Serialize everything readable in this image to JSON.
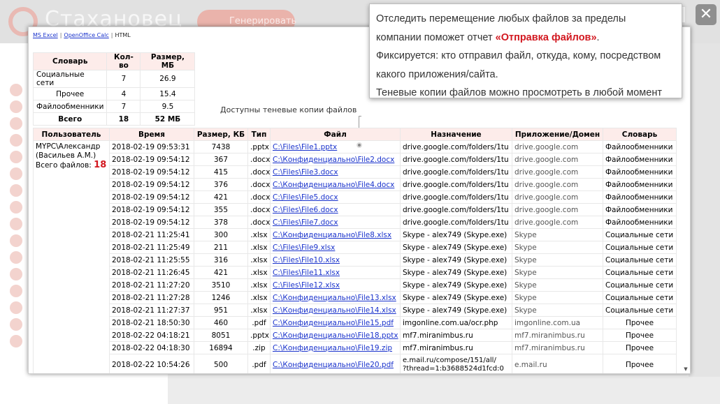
{
  "background": {
    "logo_text": "Стахановец",
    "generate_label": "Генерировать"
  },
  "close_label": "✕",
  "format_links": {
    "excel": "MS Excel",
    "calc": "OpenOffice Calc",
    "html": "HTML"
  },
  "summary": {
    "headers": [
      "Словарь",
      "Кол-во",
      "Размер, МБ"
    ],
    "rows": [
      [
        "Социальные сети",
        "7",
        "26.9"
      ],
      [
        "Прочее",
        "4",
        "15.4"
      ],
      [
        "Файлообменники",
        "7",
        "9.5"
      ]
    ],
    "total": [
      "Всего",
      "18",
      "52 МБ"
    ]
  },
  "annotation": "Доступны теневые копии файлов",
  "table": {
    "headers": [
      "Пользователь",
      "Время",
      "Размер, КБ",
      "Тип",
      "Файл",
      "Назначение",
      "Приложение/Домен",
      "Словарь"
    ],
    "user": {
      "name": "MYPC\\Александр (Васильев А.М.)",
      "files_label": "Всего файлов:",
      "files_count": "18"
    },
    "rows": [
      [
        "2018-02-19 09:53:31",
        "7438",
        ".pptx",
        "C:\\Files\\File1.pptx",
        "drive.google.com/folders/1tu",
        "drive.google.com",
        "Файлообменники"
      ],
      [
        "2018-02-19 09:54:12",
        "367",
        ".docx",
        "C:\\Конфиденциально\\File2.docx",
        "drive.google.com/folders/1tu",
        "drive.google.com",
        "Файлообменники"
      ],
      [
        "2018-02-19 09:54:12",
        "415",
        ".docx",
        "C:\\Files\\File3.docx",
        "drive.google.com/folders/1tu",
        "drive.google.com",
        "Файлообменники"
      ],
      [
        "2018-02-19 09:54:12",
        "376",
        ".docx",
        "C:\\Конфиденциально\\File4.docx",
        "drive.google.com/folders/1tu",
        "drive.google.com",
        "Файлообменники"
      ],
      [
        "2018-02-19 09:54:12",
        "421",
        ".docx",
        "C:\\Files\\File5.docx",
        "drive.google.com/folders/1tu",
        "drive.google.com",
        "Файлообменники"
      ],
      [
        "2018-02-19 09:54:12",
        "355",
        ".docx",
        "C:\\Files\\File6.docx",
        "drive.google.com/folders/1tu",
        "drive.google.com",
        "Файлообменники"
      ],
      [
        "2018-02-19 09:54:12",
        "378",
        ".docx",
        "C:\\Files\\File7.docx",
        "drive.google.com/folders/1tu",
        "drive.google.com",
        "Файлообменники"
      ],
      [
        "2018-02-21 11:25:41",
        "300",
        ".xlsx",
        "C:\\Конфиденциально\\File8.xlsx",
        "Skype - alex749 (Skype.exe)",
        "Skype",
        "Социальные сети"
      ],
      [
        "2018-02-21 11:25:49",
        "211",
        ".xlsx",
        "C:\\Files\\File9.xlsx",
        "Skype - alex749 (Skype.exe)",
        "Skype",
        "Социальные сети"
      ],
      [
        "2018-02-21 11:25:55",
        "316",
        ".xlsx",
        "C:\\Files\\File10.xlsx",
        "Skype - alex749 (Skype.exe)",
        "Skype",
        "Социальные сети"
      ],
      [
        "2018-02-21 11:26:45",
        "421",
        ".xlsx",
        "C:\\Files\\File11.xlsx",
        "Skype - alex749 (Skype.exe)",
        "Skype",
        "Социальные сети"
      ],
      [
        "2018-02-21 11:27:20",
        "3510",
        ".xlsx",
        "C:\\Files\\File12.xlsx",
        "Skype - alex749 (Skype.exe)",
        "Skype",
        "Социальные сети"
      ],
      [
        "2018-02-21 11:27:28",
        "1246",
        ".xlsx",
        "C:\\Конфиденциально\\File13.xlsx",
        "Skype - alex749 (Skype.exe)",
        "Skype",
        "Социальные сети"
      ],
      [
        "2018-02-21 11:27:37",
        "951",
        ".xlsx",
        "C:\\Конфиденциально\\File14.xlsx",
        "Skype - alex749 (Skype.exe)",
        "Skype",
        "Социальные сети"
      ],
      [
        "2018-02-21 18:50:30",
        "460",
        ".pdf",
        "C:\\Конфиденциально\\File15.pdf",
        "imgonline.com.ua/ocr.php",
        "imgonline.com.ua",
        "Прочее"
      ],
      [
        "2018-02-22 04:18:21",
        "8051",
        ".pptx",
        "C:\\Конфиденциально\\File18.pptx",
        "mf7.miranimbus.ru",
        "mf7.miranimbus.ru",
        "Прочее"
      ],
      [
        "2018-02-22 04:18:30",
        "16894",
        ".zip",
        "C:\\Конфиденциально\\File19.zip",
        "mf7.miranimbus.ru",
        "mf7.miranimbus.ru",
        "Прочее"
      ]
    ],
    "last_row": {
      "time": "2018-02-22 10:54:26",
      "size": "500",
      "type": ".pdf",
      "file": "C:\\Конфиденциально\\File20.pdf",
      "dest_line1": "e.mail.ru/compose/151/all/",
      "dest_line2": "?thread=1:b3688524d1fcd:0",
      "app": "e.mail.ru",
      "dict": "Прочее"
    }
  },
  "callout": {
    "line1_pre": "Отследить перемещение любых файлов за пределы",
    "line2_pre": "компании поможет отчет ",
    "line2_accent": "«Отправка файлов»",
    "line2_post": ".",
    "line3": "Фиксируется: кто отправил файл, откуда, кому, посредством",
    "line4": "какого приложения/сайта.",
    "line5": "Теневые копии файлов можно просмотреть в любой момент"
  },
  "colors": {
    "accent": "#d2171f",
    "header_bg": "#fdecea",
    "link": "#1a33cc"
  }
}
